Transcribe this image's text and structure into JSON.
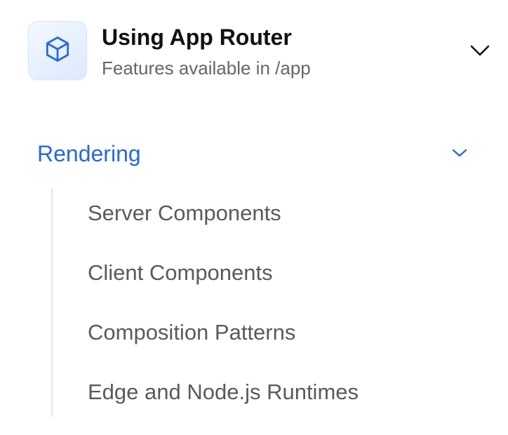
{
  "router": {
    "title": "Using App Router",
    "subtitle": "Features available in /app",
    "icon": "cube-icon",
    "toggle_icon": "chevron-down-icon"
  },
  "section": {
    "label": "Rendering",
    "toggle_icon": "chevron-down-icon",
    "expanded": true,
    "items": [
      {
        "label": "Server Components"
      },
      {
        "label": "Client Components"
      },
      {
        "label": "Composition Patterns"
      },
      {
        "label": "Edge and Node.js Runtimes"
      }
    ]
  },
  "colors": {
    "accent": "#2867e0",
    "title_text": "#111111",
    "muted_text": "#666666",
    "item_text": "#5a5a5a",
    "rail": "#e6e6e6"
  }
}
